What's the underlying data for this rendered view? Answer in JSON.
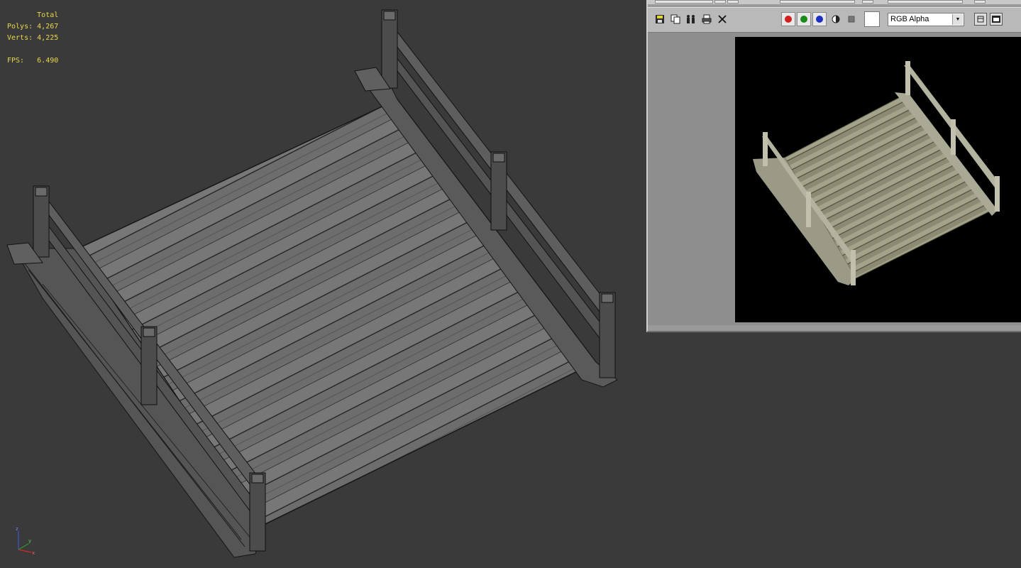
{
  "viewport": {
    "stats": {
      "total_label": "Total",
      "polys_label": "Polys:",
      "polys_value": "4,267",
      "verts_label": "Verts:",
      "verts_value": "4,225",
      "fps_label": "FPS:",
      "fps_value": "6.490"
    },
    "axis": {
      "z": "z",
      "y": "y",
      "x": "x"
    },
    "colors": {
      "background": "#3a3a3a",
      "stats_text": "#e8d84a"
    }
  },
  "frame_window": {
    "toolbar": {
      "icons": [
        "save-icon",
        "copy-icon",
        "clone-icon",
        "print-icon",
        "clear-icon"
      ],
      "channels": [
        {
          "name": "red-channel-icon",
          "color": "#d21f1f"
        },
        {
          "name": "green-channel-icon",
          "color": "#1b8a1b"
        },
        {
          "name": "blue-channel-icon",
          "color": "#1f2fbf"
        }
      ],
      "channel_display": "RGB Alpha"
    }
  }
}
